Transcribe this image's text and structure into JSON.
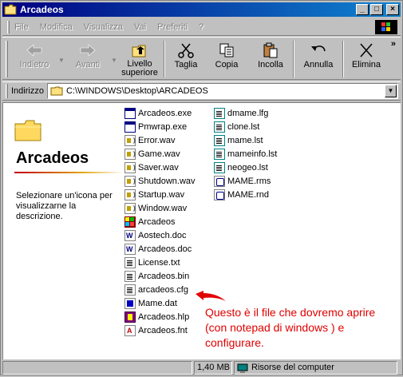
{
  "window": {
    "title": "Arcadeos",
    "controls": [
      "_",
      "□",
      "×"
    ]
  },
  "menu": [
    "File",
    "Modifica",
    "Visualizza",
    "Vai",
    "Preferiti",
    "?"
  ],
  "toolbar": {
    "back": "Indietro",
    "forward": "Avanti",
    "up_line1": "Livello",
    "up_line2": "superiore",
    "cut": "Taglia",
    "copy": "Copia",
    "paste": "Incolla",
    "undo": "Annulla",
    "delete": "Elimina",
    "more": "»"
  },
  "address": {
    "label": "Indirizzo",
    "path": "C:\\WINDOWS\\Desktop\\ARCADEOS"
  },
  "left_pane": {
    "title": "Arcadeos",
    "description": "Selezionare un'icona per visualizzarne la descrizione."
  },
  "files_col1": [
    {
      "name": "Arcadeos.exe",
      "icon": "exe-icon"
    },
    {
      "name": "Pmwrap.exe",
      "icon": "exe-icon"
    },
    {
      "name": "Error.wav",
      "icon": "wav-icon"
    },
    {
      "name": "Game.wav",
      "icon": "wav-icon"
    },
    {
      "name": "Saver.wav",
      "icon": "wav-icon"
    },
    {
      "name": "Shutdown.wav",
      "icon": "wav-icon"
    },
    {
      "name": "Startup.wav",
      "icon": "wav-icon"
    },
    {
      "name": "Window.wav",
      "icon": "wav-icon"
    },
    {
      "name": "Arcadeos",
      "icon": "app-icon"
    },
    {
      "name": "Aostech.doc",
      "icon": "doc-icon"
    },
    {
      "name": "Arcadeos.doc",
      "icon": "doc-icon"
    },
    {
      "name": "License.txt",
      "icon": "txt-icon"
    },
    {
      "name": "Arcadeos.bin",
      "icon": "bin-icon"
    },
    {
      "name": "arcadeos.cfg",
      "icon": "cfg-icon"
    },
    {
      "name": "Mame.dat",
      "icon": "dat-icon"
    },
    {
      "name": "Arcadeos.hlp",
      "icon": "hlp-icon"
    },
    {
      "name": "Arcadeos.fnt",
      "icon": "fnt-icon"
    }
  ],
  "files_col2": [
    {
      "name": "dmame.lfg",
      "icon": "lst-icon"
    },
    {
      "name": "clone.lst",
      "icon": "lst-icon"
    },
    {
      "name": "mame.lst",
      "icon": "lst-icon"
    },
    {
      "name": "mameinfo.lst",
      "icon": "lst-icon"
    },
    {
      "name": "neogeo.lst",
      "icon": "lst-icon"
    },
    {
      "name": "MAME.rms",
      "icon": "mame-icon"
    },
    {
      "name": "MAME.rnd",
      "icon": "mame-icon"
    }
  ],
  "annotation": {
    "text": "Questo è il file che dovremo aprire (con notepad di windows ) e configurare.",
    "color": "#e00000"
  },
  "status": {
    "size": "1,40 MB",
    "location": "Risorse del computer"
  },
  "colors": {
    "titlebar_start": "#000080",
    "titlebar_end": "#1084d0",
    "chrome": "#c0c0c0"
  }
}
